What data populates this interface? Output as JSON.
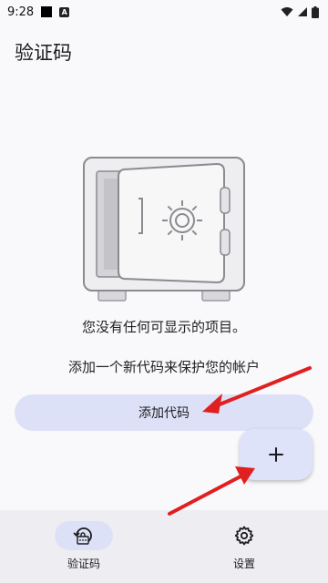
{
  "status_bar": {
    "time": "9:28",
    "a_badge": "A"
  },
  "header": {
    "title": "验证码"
  },
  "empty_state": {
    "message": "您没有任何可显示的项目。",
    "hint": "添加一个新代码来保护您的帐户"
  },
  "actions": {
    "add_code_label": "添加代码",
    "fab_icon": "plus-icon"
  },
  "bottom_nav": {
    "items": [
      {
        "label": "验证码",
        "icon": "authenticator-icon",
        "selected": true
      },
      {
        "label": "设置",
        "icon": "gear-icon",
        "selected": false
      }
    ]
  },
  "colors": {
    "background": "#f9f9fb",
    "button_fill": "#dde1f7",
    "nav_background": "#eeeef2",
    "annotation_arrow": "#e02020"
  }
}
